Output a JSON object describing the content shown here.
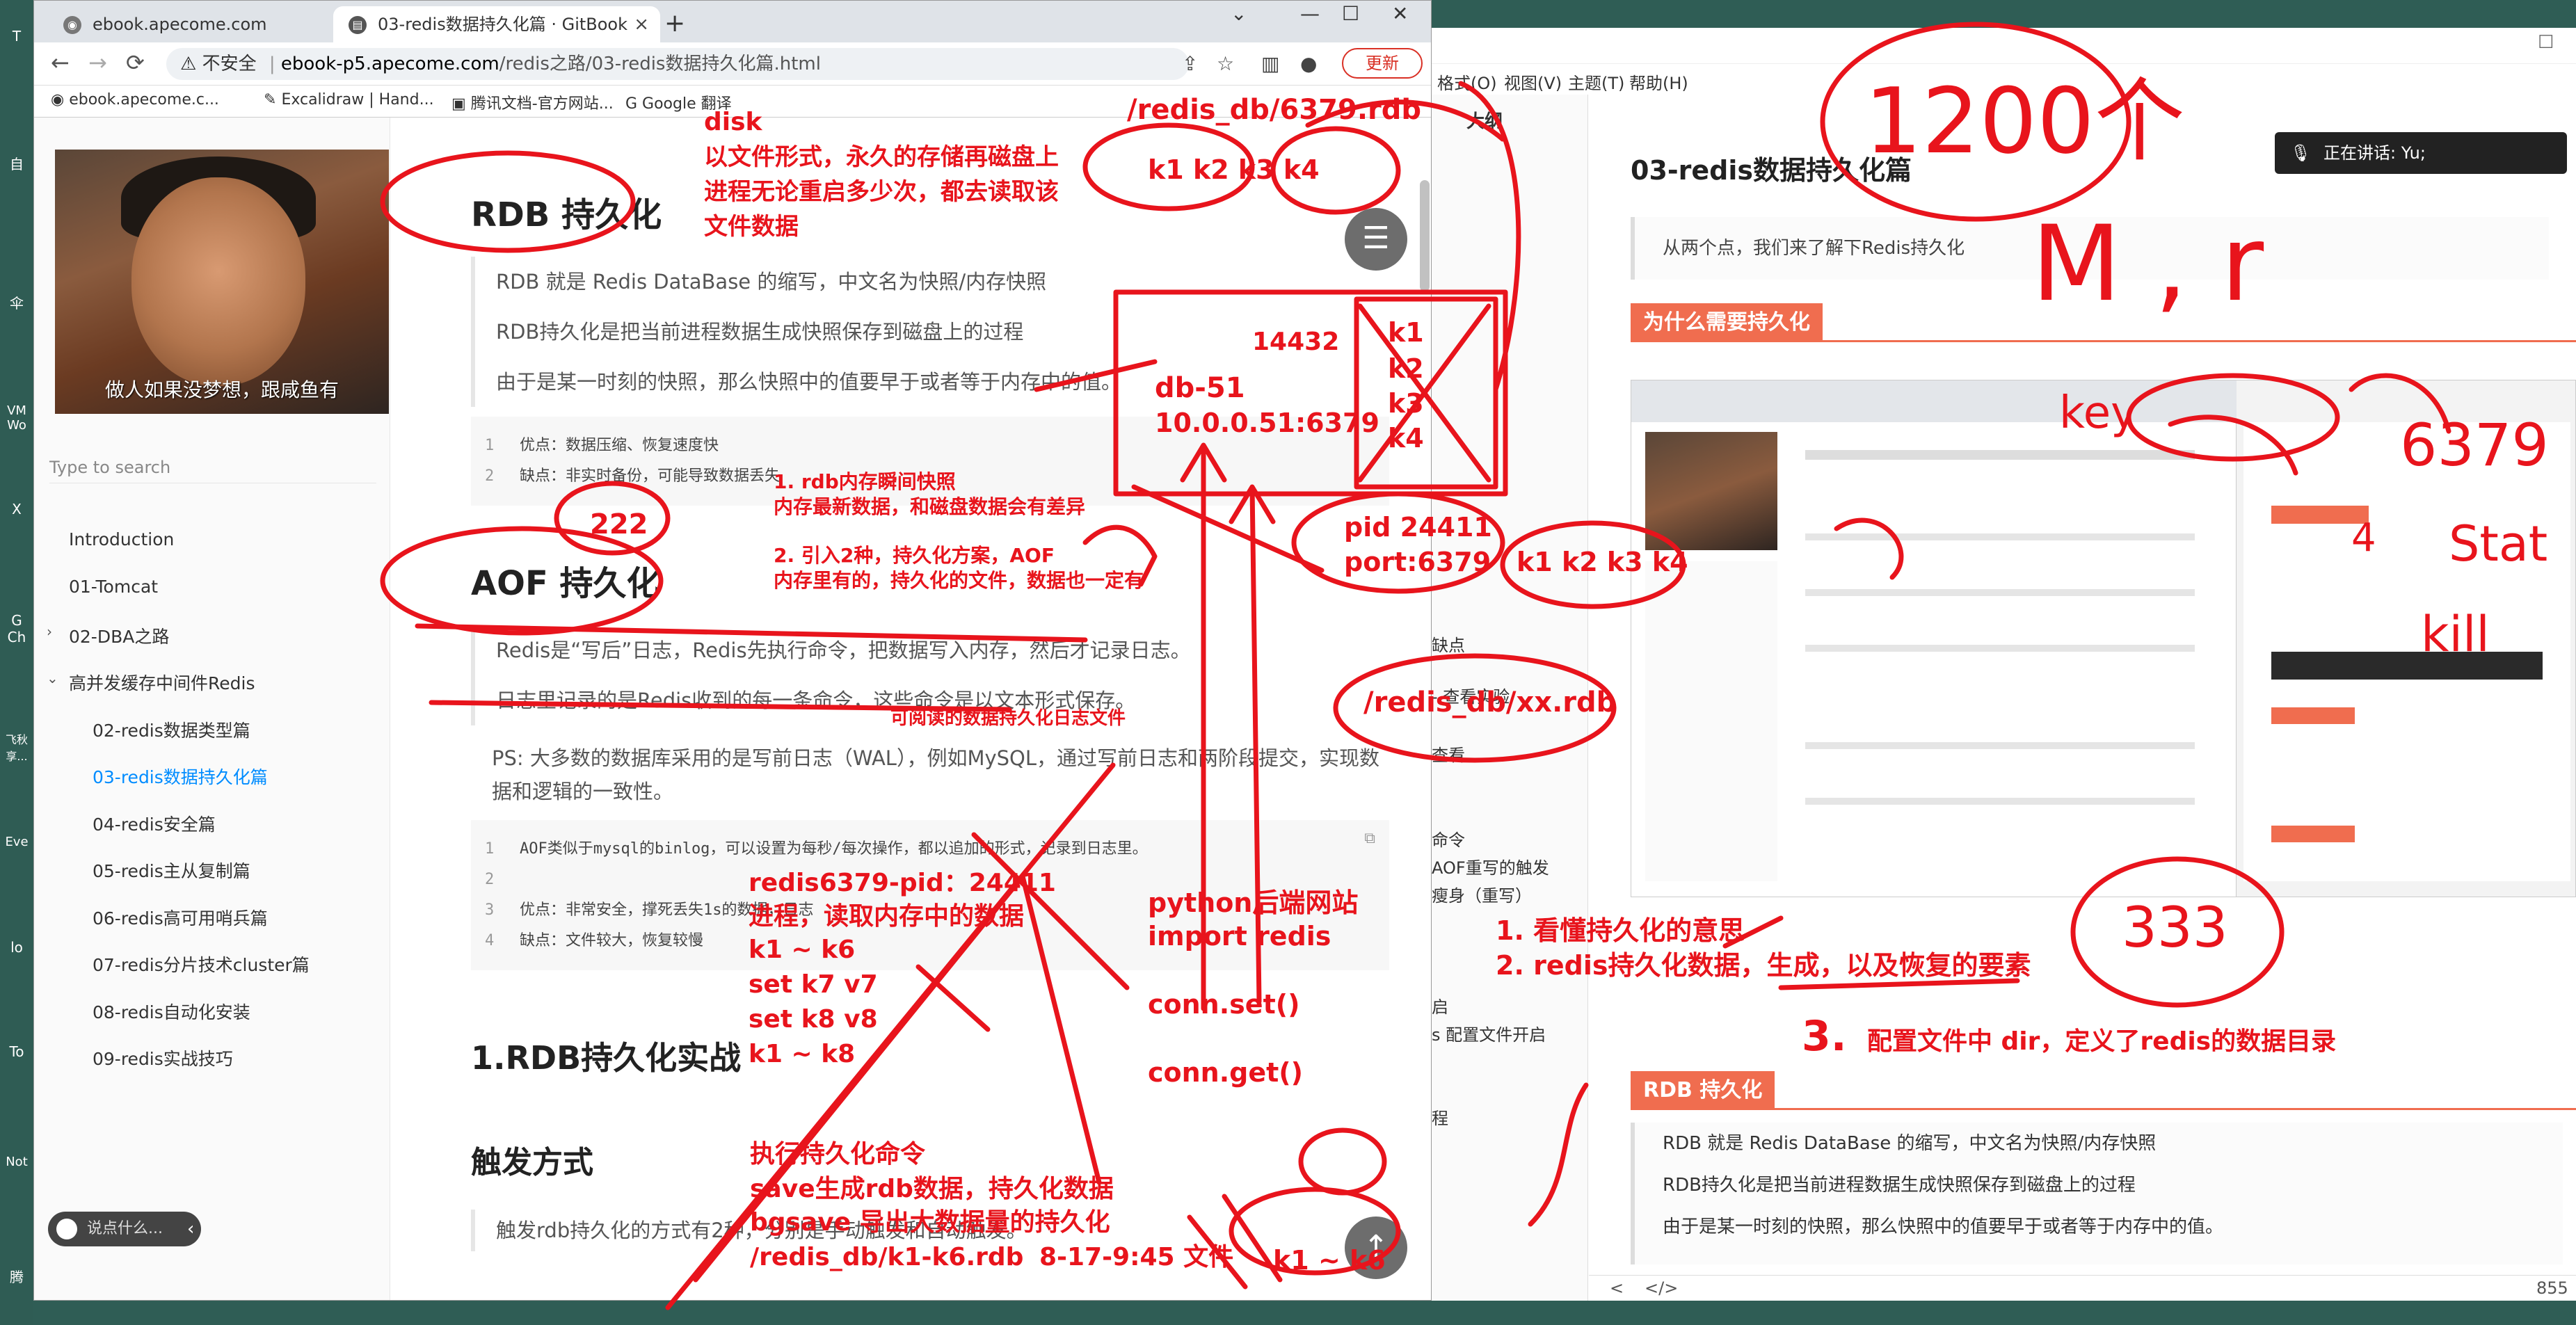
{
  "browser": {
    "tabs": [
      {
        "title": "ebook.apecome.com"
      },
      {
        "title": "03-redis数据持久化篇 · GitBook"
      }
    ],
    "new_tab": "+",
    "nav": {
      "back": "←",
      "forward": "→",
      "reload": "⟳"
    },
    "address": {
      "warning": "不安全",
      "host": "ebook-p5.apecome.com",
      "path": "/redis之路/03-redis数据持久化篇.html"
    },
    "update_button": "更新",
    "bookmarks": [
      {
        "label": "ebook.apecome.c..."
      },
      {
        "label": "Excalidraw | Hand..."
      },
      {
        "label": "腾讯文档-官方网站..."
      },
      {
        "label": "Google 翻译"
      }
    ]
  },
  "gitbook": {
    "sidebar": {
      "meme_caption": "做人如果没梦想，跟咸鱼有",
      "search_placeholder": "Type to search",
      "items": [
        {
          "label": "Introduction"
        },
        {
          "label": "01-Tomcat"
        },
        {
          "label": "02-DBA之路"
        },
        {
          "label": "高并发缓存中间件Redis"
        },
        {
          "label": "02-redis数据类型篇"
        },
        {
          "label": "03-redis数据持久化篇"
        },
        {
          "label": "04-redis安全篇"
        },
        {
          "label": "05-redis主从复制篇"
        },
        {
          "label": "06-redis高可用哨兵篇"
        },
        {
          "label": "07-redis分片技术cluster篇"
        },
        {
          "label": "08-redis自动化安装"
        },
        {
          "label": "09-redis实战技巧"
        }
      ],
      "chat_placeholder": "说点什么..."
    },
    "content": {
      "rdb_heading": "RDB 持久化",
      "rdb_quote": [
        "RDB 就是 Redis DataBase 的缩写，中文名为快照/内存快照",
        "RDB持久化是把当前进程数据生成快照保存到磁盘上的过程",
        "由于是某一时刻的快照，那么快照中的值要早于或者等于内存中的值。"
      ],
      "rdb_code": [
        {
          "num": "1",
          "text": "优点：数据压缩、恢复速度快"
        },
        {
          "num": "2",
          "text": "缺点：非实时备份，可能导致数据丢失"
        }
      ],
      "aof_heading": "AOF 持久化",
      "aof_quote": [
        "Redis是“写后”日志，Redis先执行命令，把数据写入内存，然后才记录日志。",
        "日志里记录的是Redis收到的每一条命令，这些命令是以文本形式保存。"
      ],
      "aof_ps": "PS: 大多数的数据库采用的是写前日志（WAL），例如MySQL，通过写前日志和两阶段提交，实现数据和逻辑的一致性。",
      "aof_code": [
        {
          "num": "1",
          "text": "AOF类似于mysql的binlog，可以设置为每秒/每次操作，都以追加的形式，记录到日志里。"
        },
        {
          "num": "2",
          "text": ""
        },
        {
          "num": "3",
          "text": "优点：非常安全，撑死丢失1s的数据，日志"
        },
        {
          "num": "4",
          "text": "缺点：文件较大，恢复较慢"
        }
      ],
      "practice_heading": "1.RDB持久化实战",
      "trigger_heading": "触发方式",
      "trigger_text": "触发rdb持久化的方式有2种，分别是手动触发和自动触发。"
    }
  },
  "typora": {
    "menu": [
      "格式(O)",
      "视图(V)",
      "主题(T)",
      "帮助(H)"
    ],
    "outline_label": "大纲",
    "outline_items": [
      "缺点",
      "- 查看实验",
      "查看",
      "命令",
      "AOF重写的触发",
      "瘦身（重写）",
      "启",
      "s 配置文件开启",
      "程"
    ],
    "title": "03-redis数据持久化篇",
    "intro_quote": "从两个点，我们来了解下Redis持久化",
    "section_why": "为什么需要持久化",
    "section_rdb": "RDB 持久化",
    "rdb_quote": [
      "RDB 就是 Redis DataBase 的缩写，中文名为快照/内存快照",
      "RDB持久化是把当前进程数据生成快照保存到磁盘上的过程",
      "由于是某一时刻的快照，那么快照中的值要早于或者等于内存中的值。"
    ],
    "status_left": "<",
    "status_code": "</>",
    "status_right": "855",
    "mic_text": "正在讲话: Yu;"
  },
  "desktop_icons": [
    "T",
    "自",
    "伞",
    "VM Wo",
    "X",
    "G Ch",
    "飞秋 享...",
    "Eve",
    "lo",
    "To",
    "Not",
    "腾"
  ],
  "annotations": {
    "disk": "disk",
    "disk_desc_1": "以文件形式，永久的存储再磁盘上",
    "disk_desc_2": "进程无论重启多少次，都去读取该",
    "disk_desc_3": "文件数据",
    "rdb_path_top": "/redis_db/6379.rdb",
    "keys_top": "k1 k2 k3 k4",
    "box_pid": "14432",
    "box_db": "db-51",
    "box_addr": "10.0.0.51:6379",
    "box_keys": [
      "k1",
      "k2",
      "k3",
      "k4"
    ],
    "pid": "pid  24411",
    "port": "port:6379",
    "keys_mid": "k1 k2 k3 k4",
    "xx_rdb": "/redis_db/xx.rdb",
    "rdb_note_1": "1. rdb内存瞬间快照",
    "rdb_note_2": "内存最新数据，和磁盘数据会有差异",
    "aof_note_1": "2. 引入2种，持久化方案，AOF",
    "aof_note_2": "内存里有的，持久化的文件，数据也一定有",
    "readable_note": "可阅读的数据持久化日志文件",
    "process_1": "redis6379-pid：24411",
    "process_2": "进程，读取内存中的数据",
    "process_3": "k1 ~ k6",
    "process_4": "set  k7 v7",
    "process_5": "set k8 v8",
    "process_6": "k1 ~ k8",
    "python_1": "python后端网站",
    "python_2": "import redis",
    "conn_set": "conn.set()",
    "conn_get": "conn.get()",
    "exec_1": "执行持久化命令",
    "exec_2": "save生成rdb数据，持久化数据",
    "exec_3": "bgsave 导出大数据量的持久化",
    "exec_4": "/redis_db/k1-k6.rdb",
    "exec_5": "8-17-9:45 文件",
    "k1k6": "k1 ~ k6",
    "circle_222": "222",
    "circle_333": "333",
    "big_1200": "1200个",
    "big_mr": "M , r",
    "goal_1": "1. 看懂持久化的意思",
    "goal_2": "2. redis持久化数据，生成，以及恢复的要素",
    "goal_3": "3.",
    "goal_3_text": "配置文件中  dir，定义了redis的数据目录",
    "right_key": "key",
    "right_6379": "6379",
    "right_4": "4",
    "right_stat": "Stat",
    "right_kill": "kill"
  }
}
